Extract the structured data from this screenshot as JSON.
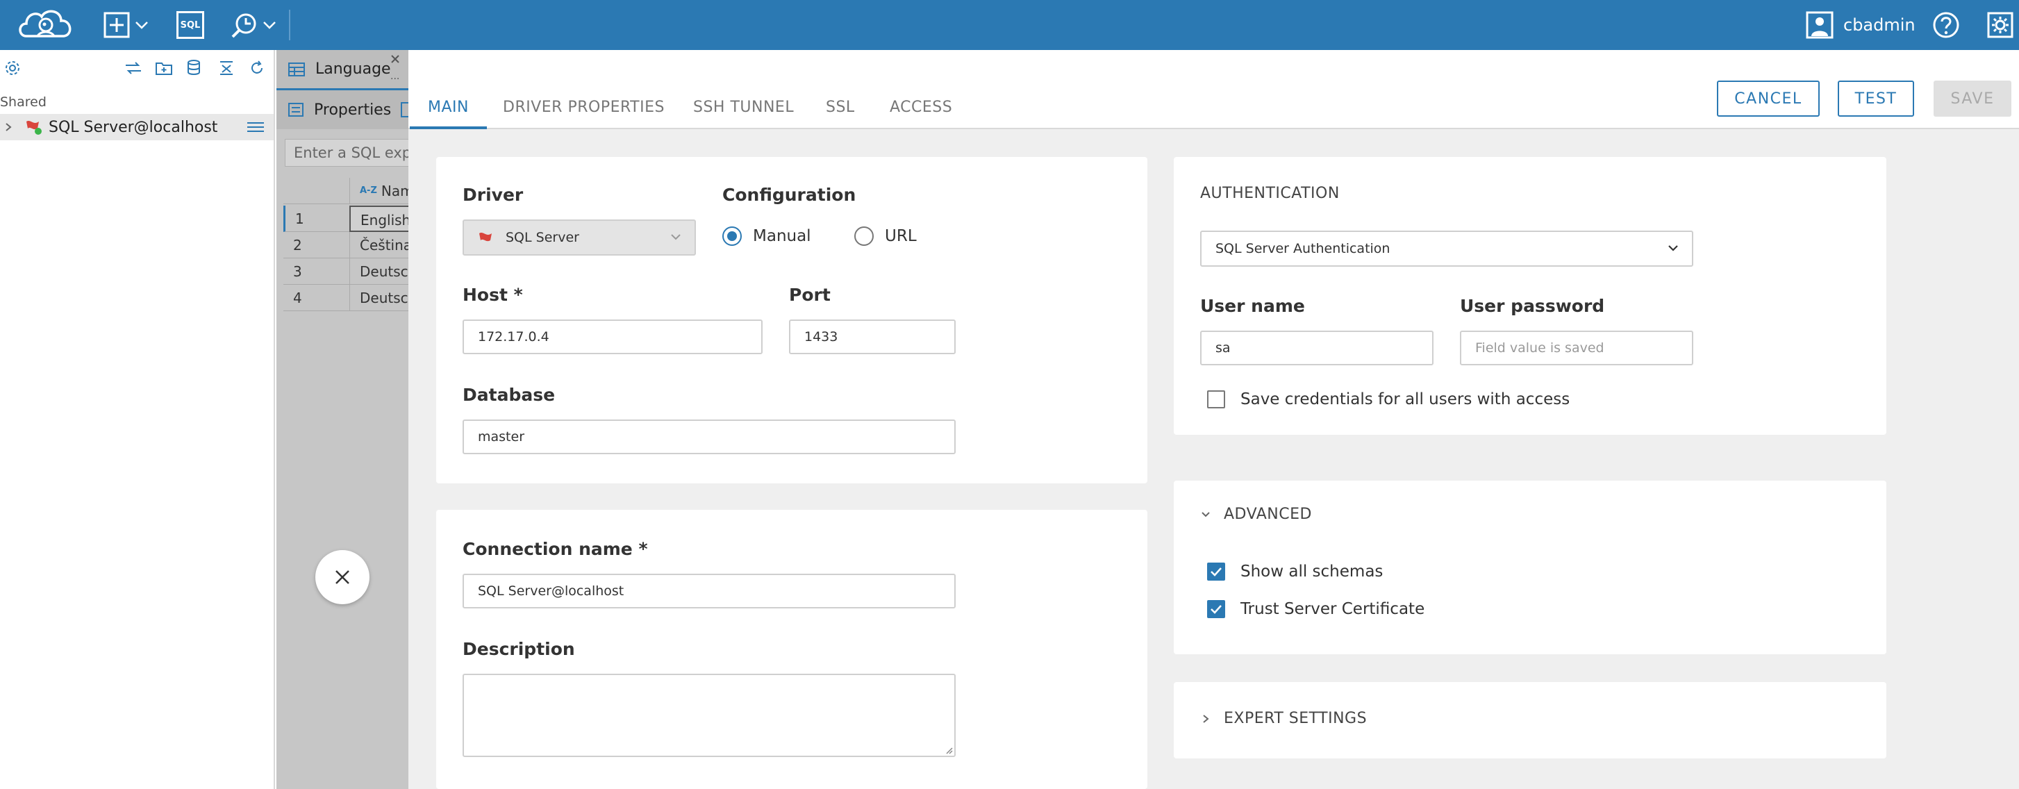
{
  "topbar": {
    "user_name": "cbadmin",
    "icons": [
      "cloudbeaver-logo-icon",
      "new-connection-icon",
      "chevron-down-icon",
      "sql-editor-icon",
      "tools-icon",
      "chevron-down-icon",
      "user-icon",
      "help-icon",
      "settings-icon"
    ],
    "sql_icon_text": "SQL",
    "color": "#2b79b3"
  },
  "navigator": {
    "shared_label": "Shared",
    "node_label": "SQL Server@localhost",
    "toolbar_icons": [
      "settings-icon",
      "link-icon",
      "new-folder-icon",
      "database-icon",
      "collapse-icon",
      "refresh-icon"
    ]
  },
  "editor": {
    "tab_title": "Language",
    "tab_more": "...",
    "properties_tab": "Properties",
    "sql_placeholder": "Enter a SQL exp",
    "column_header": "Nam",
    "rows": [
      {
        "num": "1",
        "value": "English"
      },
      {
        "num": "2",
        "value": "Čeština"
      },
      {
        "num": "3",
        "value": "Deutsch"
      },
      {
        "num": "4",
        "value": "Deutsch"
      }
    ]
  },
  "dialog": {
    "tabs": [
      "MAIN",
      "DRIVER PROPERTIES",
      "SSH TUNNEL",
      "SSL",
      "ACCESS"
    ],
    "active_tab": "MAIN",
    "buttons": {
      "cancel": "CANCEL",
      "test": "TEST",
      "save": "SAVE"
    },
    "driver_label": "Driver",
    "driver_value": "SQL Server",
    "configuration_label": "Configuration",
    "config_options": {
      "manual": "Manual",
      "url": "URL"
    },
    "config_selected": "Manual",
    "host_label": "Host *",
    "host_value": "172.17.0.4",
    "port_label": "Port",
    "port_value": "1433",
    "database_label": "Database",
    "database_value": "master",
    "connection_name_label": "Connection name *",
    "connection_name_value": "SQL Server@localhost",
    "description_label": "Description",
    "description_value": "",
    "auth": {
      "title": "AUTHENTICATION",
      "method": "SQL Server Authentication",
      "username_label": "User name",
      "username_value": "sa",
      "password_label": "User password",
      "password_placeholder": "Field value is saved",
      "save_credentials": "Save credentials for all users with access",
      "save_credentials_checked": false
    },
    "advanced": {
      "title": "ADVANCED",
      "show_all_schemas": "Show all schemas",
      "show_all_schemas_checked": true,
      "trust_server_certificate": "Trust Server Certificate",
      "trust_server_certificate_checked": true
    },
    "expert_settings": "EXPERT SETTINGS"
  }
}
